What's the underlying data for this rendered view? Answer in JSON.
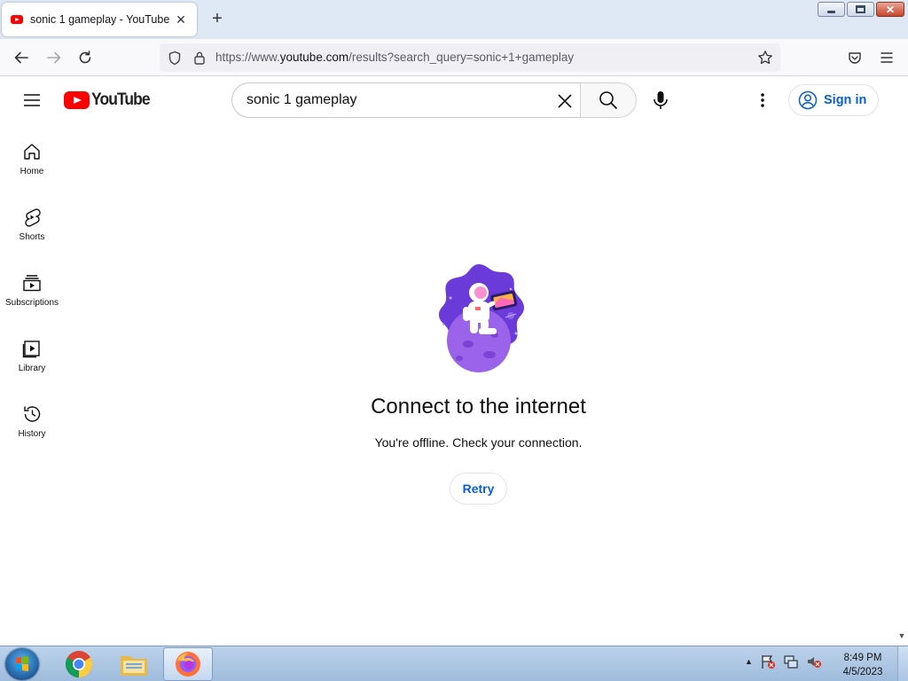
{
  "browser": {
    "tab_title": "sonic 1 gameplay - YouTube",
    "tab_close": "✕",
    "new_tab": "+",
    "url_prefix": "https://www.",
    "url_host": "youtube.com",
    "url_path": "/results?search_query=sonic+1+gameplay"
  },
  "youtube": {
    "logo_text": "YouTube",
    "search_value": "sonic 1 gameplay",
    "signin_label": "Sign in",
    "brand_red": "#ff0000",
    "link_blue": "#065fd4"
  },
  "sidebar": {
    "items": [
      {
        "label": "Home",
        "icon": "home-icon"
      },
      {
        "label": "Shorts",
        "icon": "shorts-icon"
      },
      {
        "label": "Subscriptions",
        "icon": "subscriptions-icon"
      },
      {
        "label": "Library",
        "icon": "library-icon"
      },
      {
        "label": "History",
        "icon": "history-icon"
      }
    ]
  },
  "offline": {
    "title": "Connect to the internet",
    "subtitle": "You're offline. Check your connection.",
    "retry_label": "Retry",
    "illustration": "astronaut-on-planet-illustration"
  },
  "taskbar": {
    "apps": [
      "chrome-icon",
      "file-explorer-icon",
      "firefox-icon"
    ],
    "active_app": "firefox-icon",
    "time": "8:49 PM",
    "date": "4/5/2023"
  }
}
